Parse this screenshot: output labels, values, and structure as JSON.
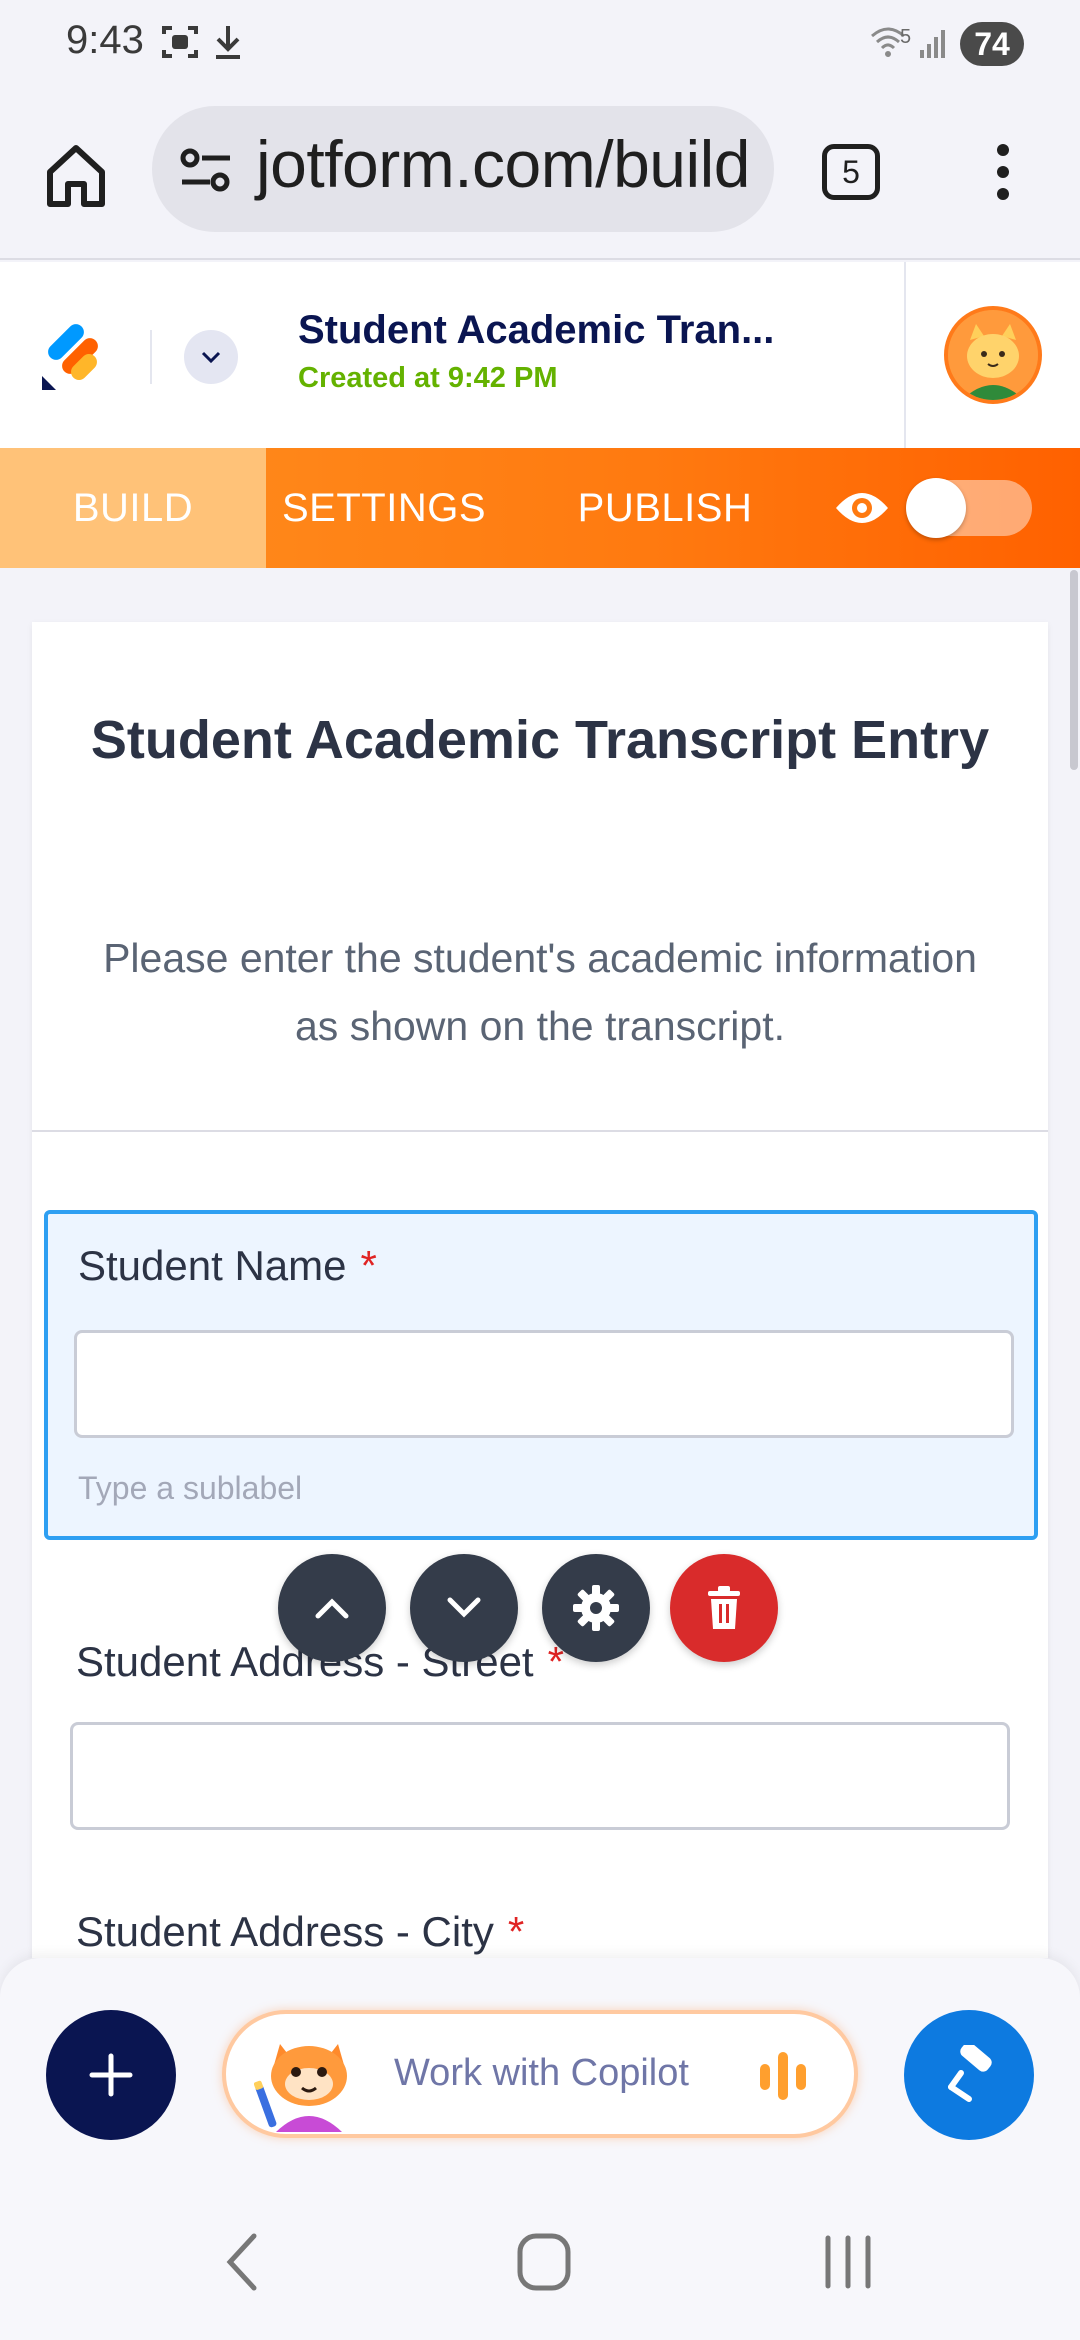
{
  "status_bar": {
    "time": "9:43",
    "battery": "74",
    "wifi_label": "5"
  },
  "browser": {
    "url": "jotform.com/build",
    "tab_count": "5"
  },
  "header": {
    "form_title": "Student Academic Tran...",
    "created_text": "Created at 9:42 PM"
  },
  "nav": {
    "tabs": [
      {
        "label": "BUILD",
        "active": true
      },
      {
        "label": "SETTINGS",
        "active": false
      },
      {
        "label": "PUBLISH",
        "active": false
      }
    ],
    "preview_toggle_on": false
  },
  "form": {
    "heading": "Student Academic Transcript Entry",
    "description": "Please enter the student's academic information as shown on the transcript.",
    "fields": [
      {
        "label": "Student Name",
        "required_mark": "*",
        "sublabel_placeholder": "Type a sublabel",
        "selected": true
      },
      {
        "label": "Student Address - Street",
        "required_mark": "*"
      },
      {
        "label": "Student Address - City",
        "required_mark": "*"
      }
    ]
  },
  "bottom": {
    "copilot_label": "Work with Copilot"
  },
  "colors": {
    "brand_navy": "#0a1551",
    "accent_orange": "#ff7a10",
    "select_blue": "#2e9ff2",
    "delete_red": "#d92b2b",
    "created_green": "#64b200"
  }
}
